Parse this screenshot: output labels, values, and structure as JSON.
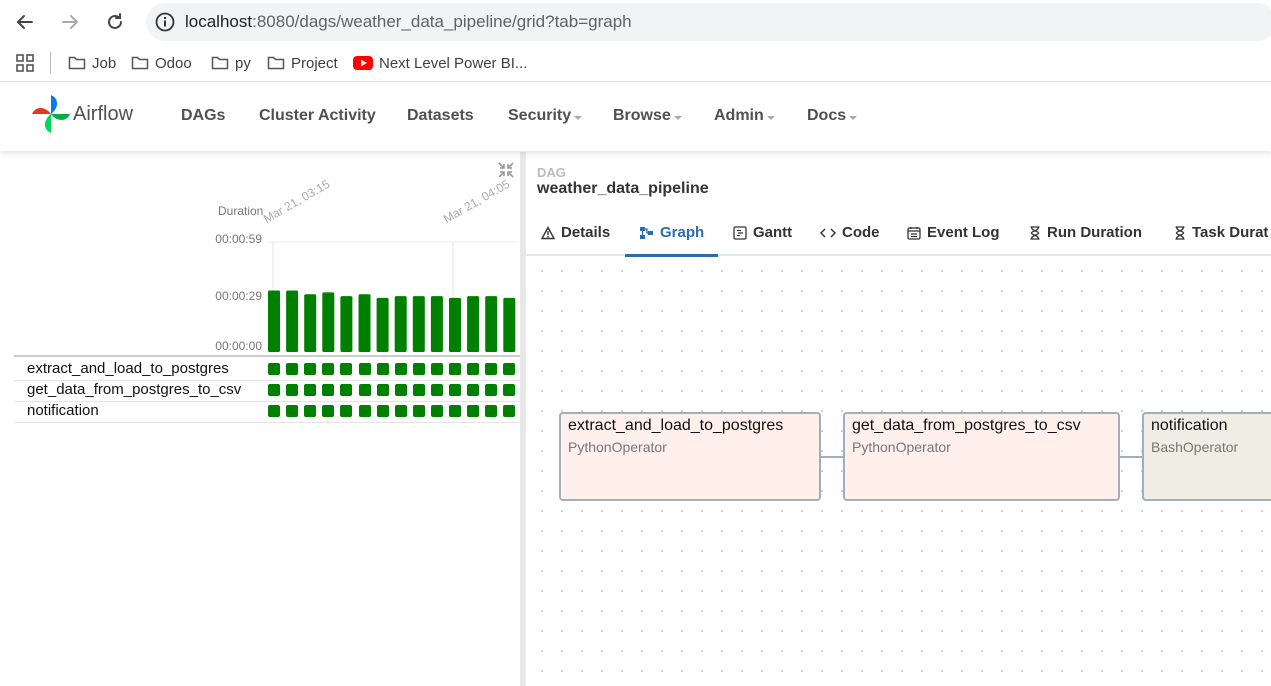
{
  "browser": {
    "url_host": "localhost",
    "url_rest": ":8080/dags/weather_data_pipeline/grid?tab=graph",
    "bookmarks": [
      {
        "label": "Job",
        "icon": "folder-icon"
      },
      {
        "label": "Odoo",
        "icon": "folder-icon"
      },
      {
        "label": "py",
        "icon": "folder-icon"
      },
      {
        "label": "Project",
        "icon": "folder-icon"
      },
      {
        "label": "Next Level Power BI...",
        "icon": "youtube-icon"
      }
    ]
  },
  "navbar": {
    "brand": "Airflow",
    "items": [
      {
        "label": "DAGs",
        "dropdown": false
      },
      {
        "label": "Cluster Activity",
        "dropdown": false
      },
      {
        "label": "Datasets",
        "dropdown": false
      },
      {
        "label": "Security",
        "dropdown": true
      },
      {
        "label": "Browse",
        "dropdown": true
      },
      {
        "label": "Admin",
        "dropdown": true
      },
      {
        "label": "Docs",
        "dropdown": true
      }
    ]
  },
  "grid": {
    "duration_label": "Duration",
    "ticks": [
      "00:00:59",
      "00:00:29",
      "00:00:00"
    ],
    "run_dates": [
      "Mar 21, 03:15",
      "Mar 21, 04:05"
    ],
    "tasks": [
      {
        "name": "extract_and_load_to_postgres"
      },
      {
        "name": "get_data_from_postgres_to_csv"
      },
      {
        "name": "notification"
      }
    ],
    "status_color": "#008000"
  },
  "chart_data": {
    "type": "bar",
    "title": "",
    "ylabel": "Duration",
    "ylim": [
      0,
      59
    ],
    "ytick_labels": [
      "00:00:00",
      "00:00:29",
      "00:00:59"
    ],
    "x_labels": [
      "Mar 21, 03:15",
      "Mar 21, 04:05"
    ],
    "values": [
      33,
      33,
      31,
      32,
      30,
      31,
      29,
      30,
      30,
      30,
      29,
      30,
      30,
      29
    ],
    "color": "#008000"
  },
  "dag": {
    "label": "DAG",
    "title": "weather_data_pipeline",
    "tabs": [
      {
        "label": "Details",
        "icon": "warning-icon",
        "active": false
      },
      {
        "label": "Graph",
        "icon": "graph-icon",
        "active": true
      },
      {
        "label": "Gantt",
        "icon": "gantt-icon",
        "active": false
      },
      {
        "label": "Code",
        "icon": "code-icon",
        "active": false
      },
      {
        "label": "Event Log",
        "icon": "event-log-icon",
        "active": false
      },
      {
        "label": "Run Duration",
        "icon": "hourglass-icon",
        "active": false
      },
      {
        "label": "Task Durat",
        "icon": "hourglass-icon",
        "active": false
      }
    ],
    "nodes": [
      {
        "name": "extract_and_load_to_postgres",
        "operator": "PythonOperator",
        "color": "#fff0ec"
      },
      {
        "name": "get_data_from_postgres_to_csv",
        "operator": "PythonOperator",
        "color": "#fff0ec"
      },
      {
        "name": "notification",
        "operator": "BashOperator",
        "color": "#f0ede4"
      }
    ]
  }
}
